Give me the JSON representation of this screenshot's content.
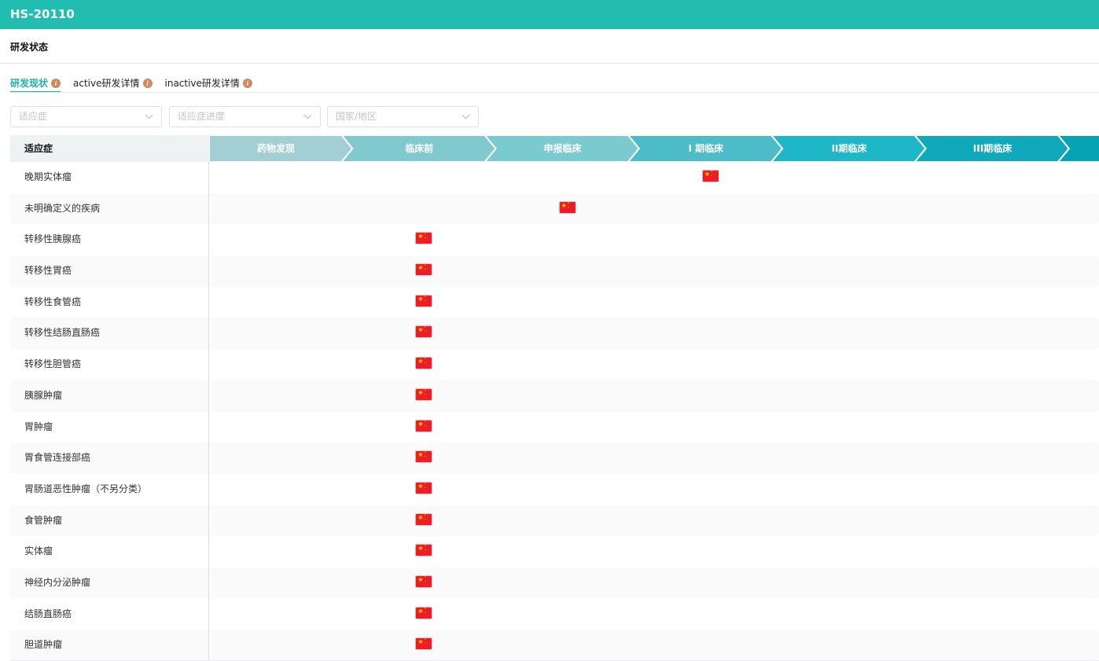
{
  "header": {
    "title": "HS-20110"
  },
  "section_title": "研发状态",
  "tabs": [
    {
      "label": "研发现状"
    },
    {
      "label": "active研发详情"
    },
    {
      "label": "inactive研发详情"
    }
  ],
  "filters": [
    {
      "placeholder": "适应症"
    },
    {
      "placeholder": "适应症进度"
    },
    {
      "placeholder": "国家/地区"
    }
  ],
  "table": {
    "first_col_header": "适应症",
    "stages": [
      {
        "label": "药物发现",
        "color": "#a2cfd4"
      },
      {
        "label": "临床前",
        "color": "#80c9ce"
      },
      {
        "label": "申报临床",
        "color": "#7acbd0"
      },
      {
        "label": "I 期临床",
        "color": "#4bbcc8"
      },
      {
        "label": "II期临床",
        "color": "#1eb7c7"
      },
      {
        "label": "III期临床",
        "color": "#10a9bc"
      },
      {
        "label": "",
        "color": "#06a3b5"
      }
    ],
    "rows": [
      {
        "indication": "晚期实体瘤",
        "stage": 3,
        "country": "china-flag"
      },
      {
        "indication": "未明确定义的疾病",
        "stage": 2,
        "country": "china-flag"
      },
      {
        "indication": "转移性胰腺癌",
        "stage": 1,
        "country": "china-flag"
      },
      {
        "indication": "转移性胃癌",
        "stage": 1,
        "country": "china-flag"
      },
      {
        "indication": "转移性食管癌",
        "stage": 1,
        "country": "china-flag"
      },
      {
        "indication": "转移性结肠直肠癌",
        "stage": 1,
        "country": "china-flag"
      },
      {
        "indication": "转移性胆管癌",
        "stage": 1,
        "country": "china-flag"
      },
      {
        "indication": "胰腺肿瘤",
        "stage": 1,
        "country": "china-flag"
      },
      {
        "indication": "胃肿瘤",
        "stage": 1,
        "country": "china-flag"
      },
      {
        "indication": "胃食管连接部癌",
        "stage": 1,
        "country": "china-flag"
      },
      {
        "indication": "胃肠道恶性肿瘤（不另分类）",
        "stage": 1,
        "country": "china-flag"
      },
      {
        "indication": "食管肿瘤",
        "stage": 1,
        "country": "china-flag"
      },
      {
        "indication": "实体瘤",
        "stage": 1,
        "country": "china-flag"
      },
      {
        "indication": "神经内分泌肿瘤",
        "stage": 1,
        "country": "china-flag"
      },
      {
        "indication": "结肠直肠癌",
        "stage": 1,
        "country": "china-flag"
      },
      {
        "indication": "胆道肿瘤",
        "stage": 1,
        "country": "china-flag"
      }
    ]
  }
}
